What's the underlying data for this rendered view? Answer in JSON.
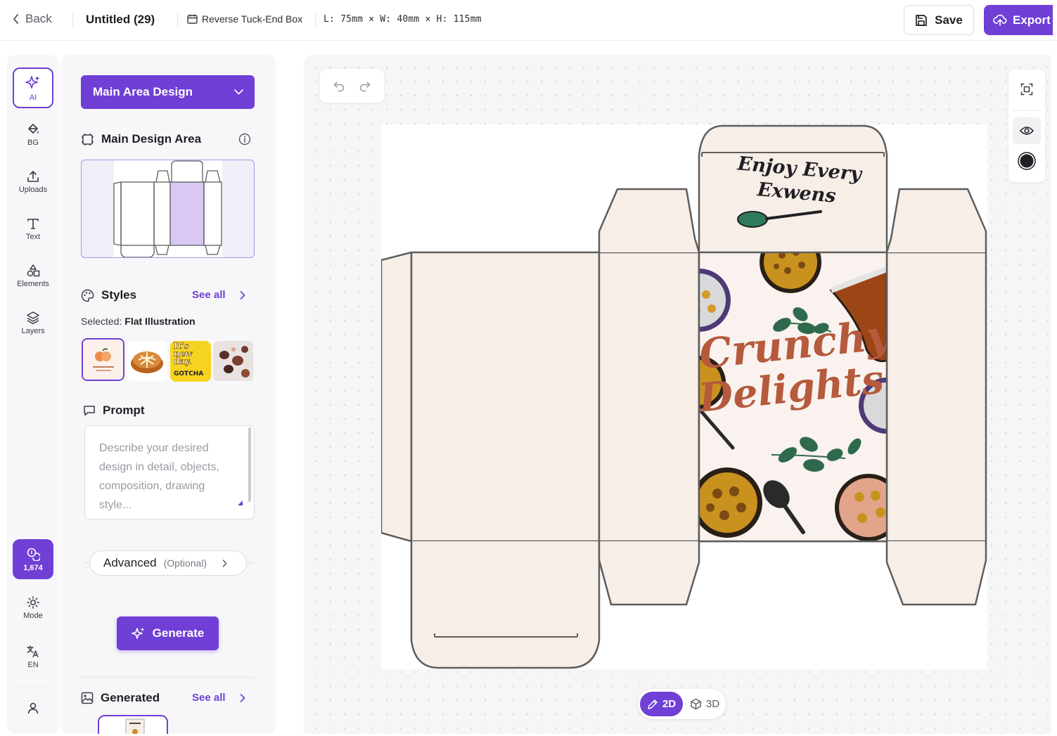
{
  "header": {
    "back_label": "Back",
    "project_title": "Untitled (29)",
    "box_type": "Reverse Tuck-End Box",
    "dimensions": "L: 75mm × W: 40mm × H: 115mm",
    "save_label": "Save",
    "export_label": "Export"
  },
  "rail": {
    "items": [
      {
        "label": "AI",
        "icon": "sparkle-icon"
      },
      {
        "label": "BG",
        "icon": "paint-bucket-icon"
      },
      {
        "label": "Uploads",
        "icon": "upload-icon"
      },
      {
        "label": "Text",
        "icon": "text-icon"
      },
      {
        "label": "Elements",
        "icon": "shapes-icon"
      },
      {
        "label": "Layers",
        "icon": "layers-icon"
      }
    ],
    "credits": "1,674",
    "mode_label": "Mode",
    "language_label": "EN"
  },
  "panel": {
    "area_select": "Main Area Design",
    "design_area_title": "Main Design Area",
    "styles_title": "Styles",
    "styles_see_all": "See all",
    "selected_prefix": "Selected:",
    "selected_style": "Flat Illustration",
    "style_thumbs": [
      "peach-illustration",
      "bun-photo",
      "its-new-day-gotcha",
      "pattern-collage"
    ],
    "thumb_text_1": "It's",
    "thumb_text_2": "new",
    "thumb_text_3": "day.",
    "thumb_text_4": "GOTCHA",
    "prompt_title": "Prompt",
    "prompt_placeholder": "Describe your desired design in detail, objects, composition, drawing style...",
    "advanced_label": "Advanced",
    "advanced_optional": "(Optional)",
    "generate_label": "Generate",
    "generated_title": "Generated",
    "generated_see_all": "See all"
  },
  "canvas": {
    "box_text_top_line1": "Enjoy Every",
    "box_text_top_line2": "Exwens",
    "box_text_main_line1": "Crunchy",
    "box_text_main_line2": "Delights",
    "mode_2d": "2D",
    "mode_3d": "3D"
  },
  "colors": {
    "accent": "#6f3fd6",
    "box_fill": "#f8eee8",
    "box_stroke": "#5d5d5d",
    "title_brown": "#b55a3c"
  }
}
